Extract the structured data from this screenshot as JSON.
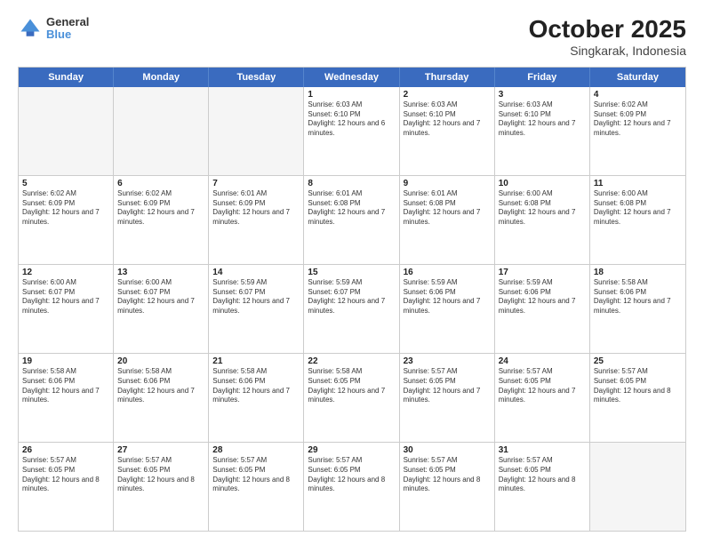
{
  "header": {
    "logo": {
      "line1": "General",
      "line2": "Blue"
    },
    "title": "October 2025",
    "location": "Singkarak, Indonesia"
  },
  "calendar": {
    "days_of_week": [
      "Sunday",
      "Monday",
      "Tuesday",
      "Wednesday",
      "Thursday",
      "Friday",
      "Saturday"
    ],
    "rows": [
      [
        {
          "day": "",
          "empty": true
        },
        {
          "day": "",
          "empty": true
        },
        {
          "day": "",
          "empty": true
        },
        {
          "day": "1",
          "sunrise": "Sunrise: 6:03 AM",
          "sunset": "Sunset: 6:10 PM",
          "daylight": "Daylight: 12 hours and 6 minutes."
        },
        {
          "day": "2",
          "sunrise": "Sunrise: 6:03 AM",
          "sunset": "Sunset: 6:10 PM",
          "daylight": "Daylight: 12 hours and 7 minutes."
        },
        {
          "day": "3",
          "sunrise": "Sunrise: 6:03 AM",
          "sunset": "Sunset: 6:10 PM",
          "daylight": "Daylight: 12 hours and 7 minutes."
        },
        {
          "day": "4",
          "sunrise": "Sunrise: 6:02 AM",
          "sunset": "Sunset: 6:09 PM",
          "daylight": "Daylight: 12 hours and 7 minutes."
        }
      ],
      [
        {
          "day": "5",
          "sunrise": "Sunrise: 6:02 AM",
          "sunset": "Sunset: 6:09 PM",
          "daylight": "Daylight: 12 hours and 7 minutes."
        },
        {
          "day": "6",
          "sunrise": "Sunrise: 6:02 AM",
          "sunset": "Sunset: 6:09 PM",
          "daylight": "Daylight: 12 hours and 7 minutes."
        },
        {
          "day": "7",
          "sunrise": "Sunrise: 6:01 AM",
          "sunset": "Sunset: 6:09 PM",
          "daylight": "Daylight: 12 hours and 7 minutes."
        },
        {
          "day": "8",
          "sunrise": "Sunrise: 6:01 AM",
          "sunset": "Sunset: 6:08 PM",
          "daylight": "Daylight: 12 hours and 7 minutes."
        },
        {
          "day": "9",
          "sunrise": "Sunrise: 6:01 AM",
          "sunset": "Sunset: 6:08 PM",
          "daylight": "Daylight: 12 hours and 7 minutes."
        },
        {
          "day": "10",
          "sunrise": "Sunrise: 6:00 AM",
          "sunset": "Sunset: 6:08 PM",
          "daylight": "Daylight: 12 hours and 7 minutes."
        },
        {
          "day": "11",
          "sunrise": "Sunrise: 6:00 AM",
          "sunset": "Sunset: 6:08 PM",
          "daylight": "Daylight: 12 hours and 7 minutes."
        }
      ],
      [
        {
          "day": "12",
          "sunrise": "Sunrise: 6:00 AM",
          "sunset": "Sunset: 6:07 PM",
          "daylight": "Daylight: 12 hours and 7 minutes."
        },
        {
          "day": "13",
          "sunrise": "Sunrise: 6:00 AM",
          "sunset": "Sunset: 6:07 PM",
          "daylight": "Daylight: 12 hours and 7 minutes."
        },
        {
          "day": "14",
          "sunrise": "Sunrise: 5:59 AM",
          "sunset": "Sunset: 6:07 PM",
          "daylight": "Daylight: 12 hours and 7 minutes."
        },
        {
          "day": "15",
          "sunrise": "Sunrise: 5:59 AM",
          "sunset": "Sunset: 6:07 PM",
          "daylight": "Daylight: 12 hours and 7 minutes."
        },
        {
          "day": "16",
          "sunrise": "Sunrise: 5:59 AM",
          "sunset": "Sunset: 6:06 PM",
          "daylight": "Daylight: 12 hours and 7 minutes."
        },
        {
          "day": "17",
          "sunrise": "Sunrise: 5:59 AM",
          "sunset": "Sunset: 6:06 PM",
          "daylight": "Daylight: 12 hours and 7 minutes."
        },
        {
          "day": "18",
          "sunrise": "Sunrise: 5:58 AM",
          "sunset": "Sunset: 6:06 PM",
          "daylight": "Daylight: 12 hours and 7 minutes."
        }
      ],
      [
        {
          "day": "19",
          "sunrise": "Sunrise: 5:58 AM",
          "sunset": "Sunset: 6:06 PM",
          "daylight": "Daylight: 12 hours and 7 minutes."
        },
        {
          "day": "20",
          "sunrise": "Sunrise: 5:58 AM",
          "sunset": "Sunset: 6:06 PM",
          "daylight": "Daylight: 12 hours and 7 minutes."
        },
        {
          "day": "21",
          "sunrise": "Sunrise: 5:58 AM",
          "sunset": "Sunset: 6:06 PM",
          "daylight": "Daylight: 12 hours and 7 minutes."
        },
        {
          "day": "22",
          "sunrise": "Sunrise: 5:58 AM",
          "sunset": "Sunset: 6:05 PM",
          "daylight": "Daylight: 12 hours and 7 minutes."
        },
        {
          "day": "23",
          "sunrise": "Sunrise: 5:57 AM",
          "sunset": "Sunset: 6:05 PM",
          "daylight": "Daylight: 12 hours and 7 minutes."
        },
        {
          "day": "24",
          "sunrise": "Sunrise: 5:57 AM",
          "sunset": "Sunset: 6:05 PM",
          "daylight": "Daylight: 12 hours and 7 minutes."
        },
        {
          "day": "25",
          "sunrise": "Sunrise: 5:57 AM",
          "sunset": "Sunset: 6:05 PM",
          "daylight": "Daylight: 12 hours and 8 minutes."
        }
      ],
      [
        {
          "day": "26",
          "sunrise": "Sunrise: 5:57 AM",
          "sunset": "Sunset: 6:05 PM",
          "daylight": "Daylight: 12 hours and 8 minutes."
        },
        {
          "day": "27",
          "sunrise": "Sunrise: 5:57 AM",
          "sunset": "Sunset: 6:05 PM",
          "daylight": "Daylight: 12 hours and 8 minutes."
        },
        {
          "day": "28",
          "sunrise": "Sunrise: 5:57 AM",
          "sunset": "Sunset: 6:05 PM",
          "daylight": "Daylight: 12 hours and 8 minutes."
        },
        {
          "day": "29",
          "sunrise": "Sunrise: 5:57 AM",
          "sunset": "Sunset: 6:05 PM",
          "daylight": "Daylight: 12 hours and 8 minutes."
        },
        {
          "day": "30",
          "sunrise": "Sunrise: 5:57 AM",
          "sunset": "Sunset: 6:05 PM",
          "daylight": "Daylight: 12 hours and 8 minutes."
        },
        {
          "day": "31",
          "sunrise": "Sunrise: 5:57 AM",
          "sunset": "Sunset: 6:05 PM",
          "daylight": "Daylight: 12 hours and 8 minutes."
        },
        {
          "day": "",
          "empty": true
        }
      ]
    ]
  }
}
